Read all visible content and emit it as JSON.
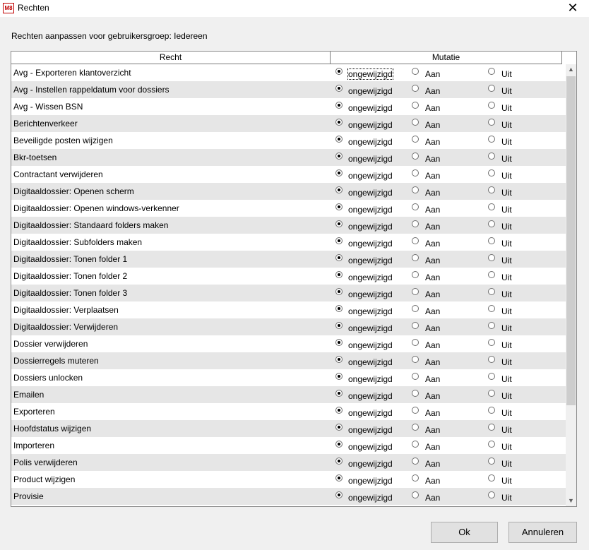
{
  "window": {
    "title": "Rechten",
    "app_icon_text": "M8",
    "close_glyph": "✕"
  },
  "subtitle": "Rechten aanpassen voor gebruikersgroep: Iedereen",
  "table": {
    "columns": [
      "Recht",
      "Mutatie"
    ],
    "option_labels": [
      "ongewijzigd",
      "Aan",
      "Uit"
    ],
    "rows": [
      {
        "recht": "Avg - Exporteren klantoverzicht",
        "selected": "ongewijzigd"
      },
      {
        "recht": "Avg - Instellen rappeldatum voor dossiers",
        "selected": "ongewijzigd"
      },
      {
        "recht": "Avg - Wissen BSN",
        "selected": "ongewijzigd"
      },
      {
        "recht": "Berichtenverkeer",
        "selected": "ongewijzigd"
      },
      {
        "recht": "Beveiligde posten wijzigen",
        "selected": "ongewijzigd"
      },
      {
        "recht": "Bkr-toetsen",
        "selected": "ongewijzigd"
      },
      {
        "recht": "Contractant verwijderen",
        "selected": "ongewijzigd"
      },
      {
        "recht": "Digitaaldossier: Openen scherm",
        "selected": "ongewijzigd"
      },
      {
        "recht": "Digitaaldossier: Openen windows-verkenner",
        "selected": "ongewijzigd"
      },
      {
        "recht": "Digitaaldossier: Standaard folders maken",
        "selected": "ongewijzigd"
      },
      {
        "recht": "Digitaaldossier: Subfolders maken",
        "selected": "ongewijzigd"
      },
      {
        "recht": "Digitaaldossier: Tonen folder 1",
        "selected": "ongewijzigd"
      },
      {
        "recht": "Digitaaldossier: Tonen folder 2",
        "selected": "ongewijzigd"
      },
      {
        "recht": "Digitaaldossier: Tonen folder 3",
        "selected": "ongewijzigd"
      },
      {
        "recht": "Digitaaldossier: Verplaatsen",
        "selected": "ongewijzigd"
      },
      {
        "recht": "Digitaaldossier: Verwijderen",
        "selected": "ongewijzigd"
      },
      {
        "recht": "Dossier verwijderen",
        "selected": "ongewijzigd"
      },
      {
        "recht": "Dossierregels muteren",
        "selected": "ongewijzigd"
      },
      {
        "recht": "Dossiers unlocken",
        "selected": "ongewijzigd"
      },
      {
        "recht": "Emailen",
        "selected": "ongewijzigd"
      },
      {
        "recht": "Exporteren",
        "selected": "ongewijzigd"
      },
      {
        "recht": "Hoofdstatus wijzigen",
        "selected": "ongewijzigd"
      },
      {
        "recht": "Importeren",
        "selected": "ongewijzigd"
      },
      {
        "recht": "Polis verwijderen",
        "selected": "ongewijzigd"
      },
      {
        "recht": "Product wijzigen",
        "selected": "ongewijzigd"
      },
      {
        "recht": "Provisie",
        "selected": "ongewijzigd"
      }
    ]
  },
  "scrollbar": {
    "up_glyph": "▲",
    "down_glyph": "▼"
  },
  "buttons": {
    "ok": "Ok",
    "cancel": "Annuleren"
  }
}
